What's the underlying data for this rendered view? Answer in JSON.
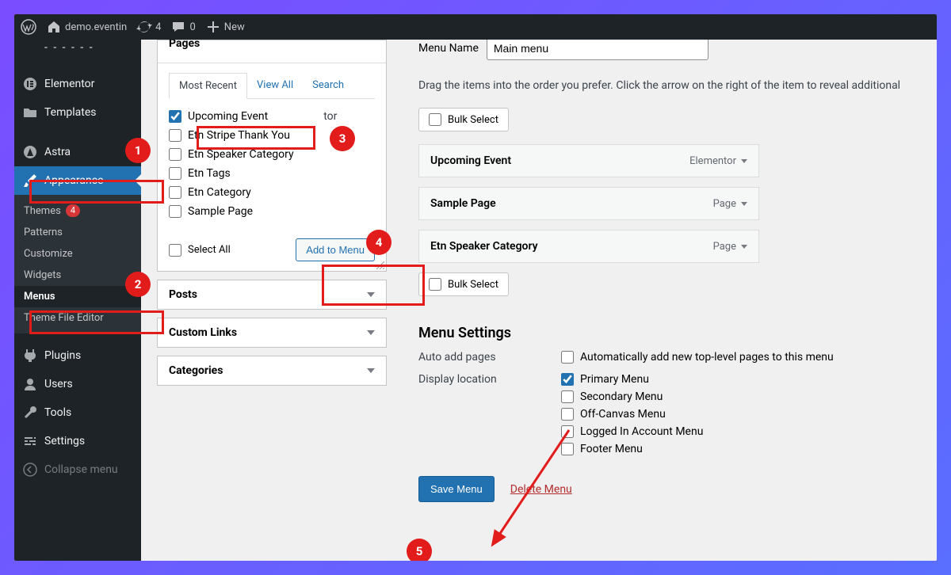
{
  "adminbar": {
    "site": "demo.eventin",
    "updates": "4",
    "comments": "0",
    "new": "New"
  },
  "sidebar": {
    "items": [
      {
        "label": "Elementor"
      },
      {
        "label": "Templates"
      },
      {
        "label": "Astra"
      },
      {
        "label": "Appearance"
      },
      {
        "label": "Plugins"
      },
      {
        "label": "Users"
      },
      {
        "label": "Tools"
      },
      {
        "label": "Settings"
      },
      {
        "label": "Collapse menu"
      }
    ],
    "appearance_sub": [
      {
        "label": "Themes",
        "badge": "4"
      },
      {
        "label": "Patterns"
      },
      {
        "label": "Customize"
      },
      {
        "label": "Widgets"
      },
      {
        "label": "Menus"
      },
      {
        "label": "Theme File Editor"
      }
    ]
  },
  "pages_box": {
    "title": "Pages",
    "tabs": [
      "Most Recent",
      "View All",
      "Search"
    ],
    "items": [
      {
        "label": "Upcoming Event",
        "checked": true,
        "suffix": "tor"
      },
      {
        "label": "Etn Stripe Thank You"
      },
      {
        "label": "Etn Speaker Category"
      },
      {
        "label": "Etn Tags"
      },
      {
        "label": "Etn Category"
      },
      {
        "label": "Sample Page"
      }
    ],
    "select_all": "Select All",
    "add_btn": "Add to Menu"
  },
  "accordions": {
    "posts": "Posts",
    "custom_links": "Custom Links",
    "categories": "Categories"
  },
  "menu_name": {
    "label": "Menu Name",
    "value": "Main menu"
  },
  "instructions": "Drag the items into the order you prefer. Click the arrow on the right of the item to reveal additional",
  "bulk_select": "Bulk Select",
  "menu_items": [
    {
      "title": "Upcoming Event",
      "type": "Elementor"
    },
    {
      "title": "Sample Page",
      "type": "Page"
    },
    {
      "title": "Etn Speaker Category",
      "type": "Page"
    }
  ],
  "menu_settings": {
    "heading": "Menu Settings",
    "auto_add_label": "Auto add pages",
    "auto_add_option": "Automatically add new top-level pages to this menu",
    "display_label": "Display location",
    "locations": [
      {
        "label": "Primary Menu",
        "checked": true
      },
      {
        "label": "Secondary Menu"
      },
      {
        "label": "Off-Canvas Menu"
      },
      {
        "label": "Logged In Account Menu"
      },
      {
        "label": "Footer Menu"
      }
    ]
  },
  "actions": {
    "save": "Save Menu",
    "delete": "Delete Menu"
  },
  "annotations": [
    "1",
    "2",
    "3",
    "4",
    "5"
  ]
}
